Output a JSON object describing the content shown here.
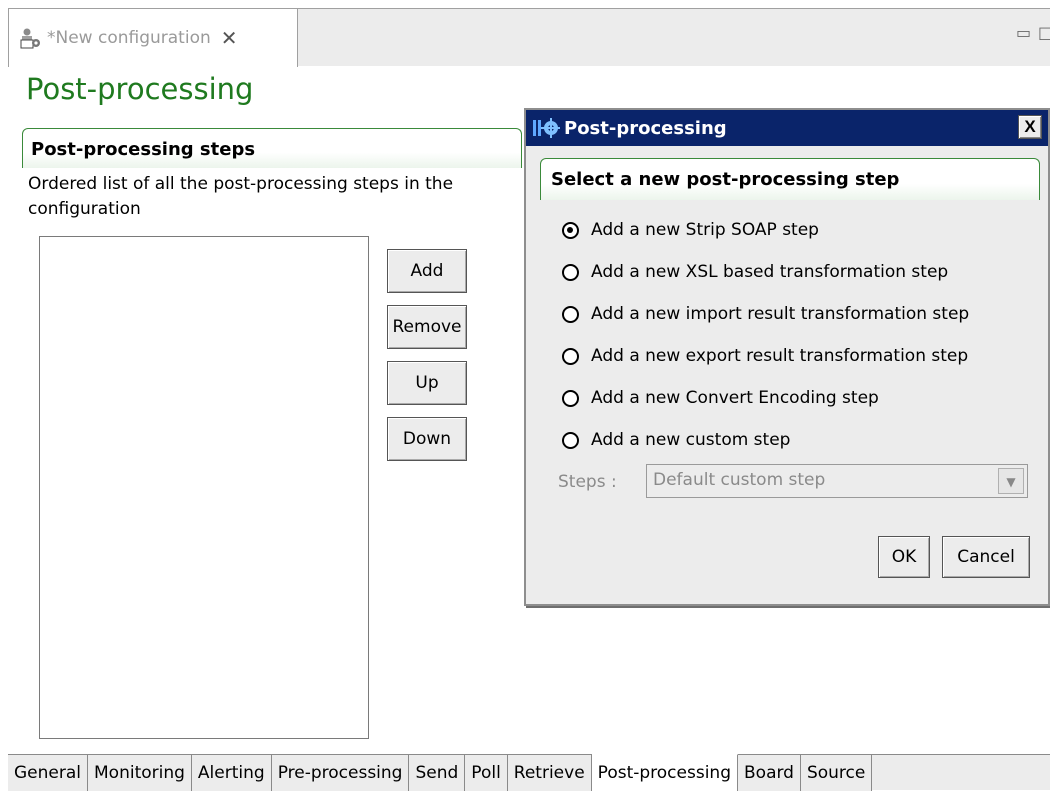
{
  "editor": {
    "tab_title": "*New configuration",
    "tab_close": "✕",
    "minimize": "▭",
    "maximize": "□"
  },
  "page": {
    "title": "Post-processing",
    "group_title": "Post-processing steps",
    "group_description": "Ordered list of all the post-processing steps in the configuration",
    "buttons": {
      "add": "Add",
      "remove": "Remove",
      "up": "Up",
      "down": "Down"
    }
  },
  "bottom_tabs": [
    {
      "label": "General",
      "active": false
    },
    {
      "label": "Monitoring",
      "active": false
    },
    {
      "label": "Alerting",
      "active": false
    },
    {
      "label": "Pre-processing",
      "active": false
    },
    {
      "label": "Send",
      "active": false
    },
    {
      "label": "Poll",
      "active": false
    },
    {
      "label": "Retrieve",
      "active": false
    },
    {
      "label": "Post-processing",
      "active": true
    },
    {
      "label": "Board",
      "active": false
    },
    {
      "label": "Source",
      "active": false
    }
  ],
  "dialog": {
    "title": "Post-processing",
    "close_label": "X",
    "group_title": "Select a new post-processing step",
    "options": [
      {
        "label": "Add a new Strip SOAP step",
        "checked": true
      },
      {
        "label": "Add a new XSL based transformation step",
        "checked": false
      },
      {
        "label": "Add a new import result transformation step",
        "checked": false
      },
      {
        "label": "Add a new export result transformation step",
        "checked": false
      },
      {
        "label": "Add a new Convert Encoding step",
        "checked": false
      },
      {
        "label": "Add a new custom step",
        "checked": false
      }
    ],
    "steps_label": "Steps :",
    "steps_value": "Default custom step",
    "ok": "OK",
    "cancel": "Cancel"
  },
  "colors": {
    "title_green": "#1f7a1f",
    "dialog_titlebar": "#0a246a",
    "group_border": "#3a8a3a"
  }
}
